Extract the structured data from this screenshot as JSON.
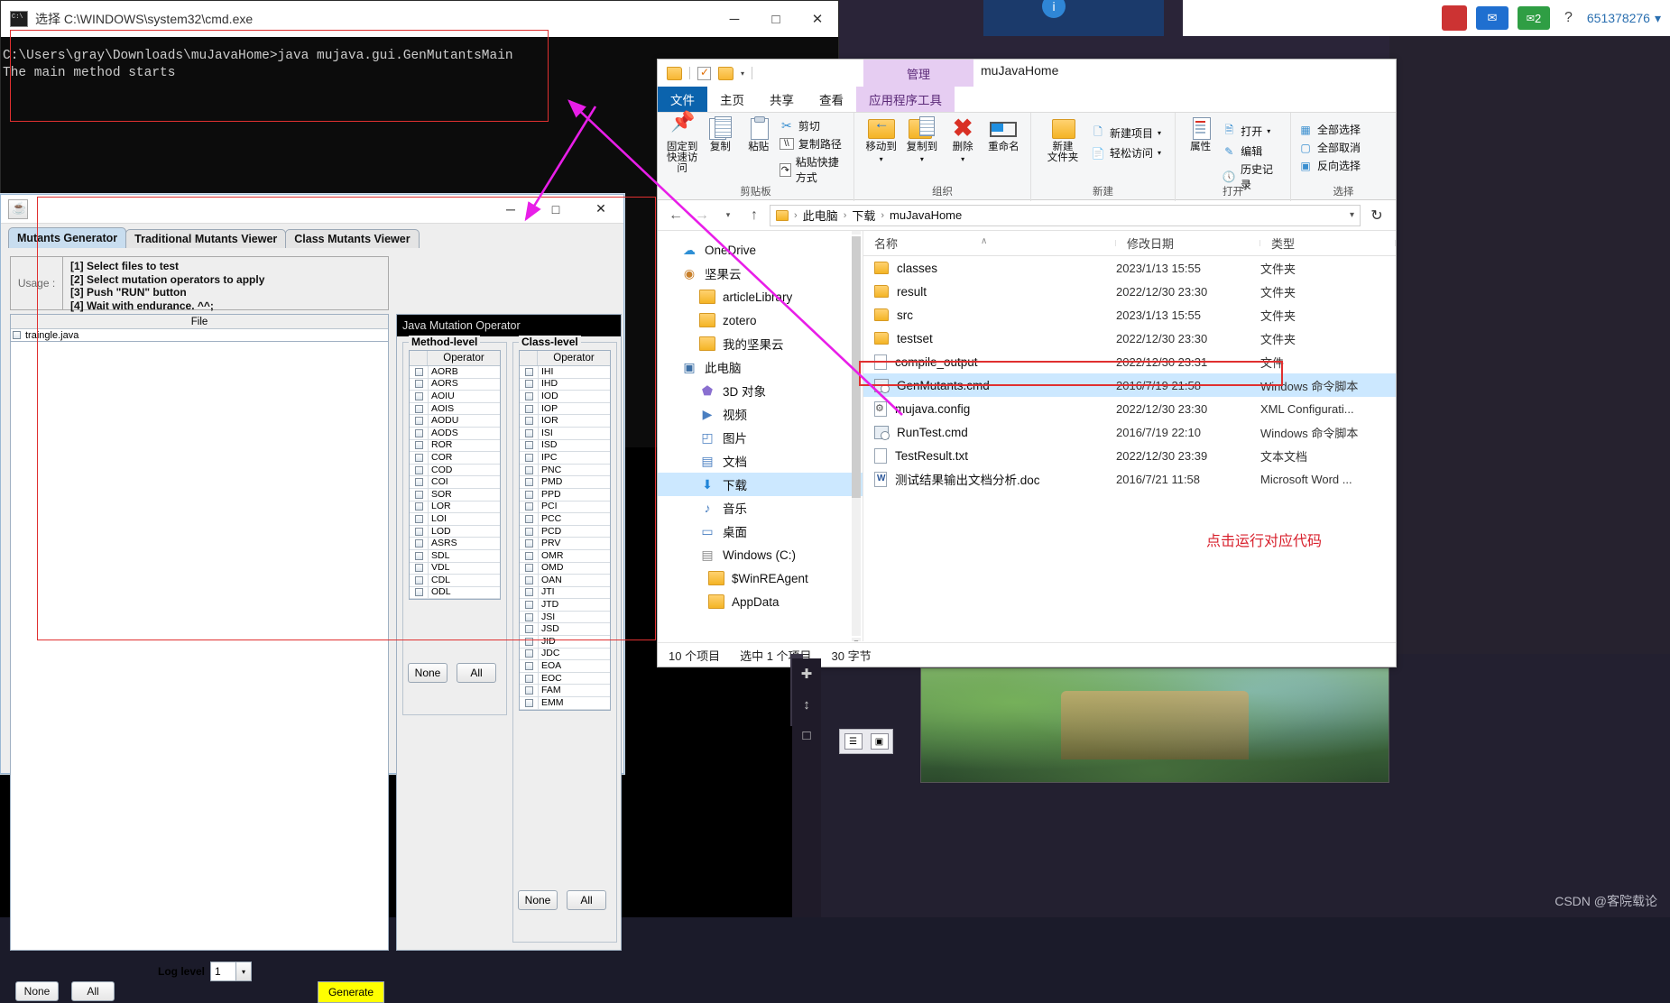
{
  "desktop": {
    "watermark": "CSDN @客院载论",
    "taskbar": {
      "mail_badge": "2",
      "help_icon": "?",
      "user_id": "651378276",
      "chevron": "▾"
    }
  },
  "cmd_window": {
    "title": "选择 C:\\WINDOWS\\system32\\cmd.exe",
    "icon": "cmd-icon",
    "minimize": "─",
    "maximize": "□",
    "close": "✕",
    "lines": [
      "C:\\Users\\gray\\Downloads\\muJavaHome>java mujava.gui.GenMutantsMain",
      "The main method starts"
    ]
  },
  "java_window": {
    "title": "",
    "minimize": "─",
    "maximize": "□",
    "close": "✕",
    "tabs": [
      {
        "label": "Mutants Generator",
        "active": true
      },
      {
        "label": "Traditional Mutants Viewer",
        "active": false
      },
      {
        "label": "Class Mutants Viewer",
        "active": false
      }
    ],
    "usage": {
      "label": "Usage :",
      "steps": [
        "[1] Select files to test",
        "[2] Select mutation operators to apply",
        "[3] Push \"RUN\" button",
        "[4] Wait with endurance. ^^;"
      ]
    },
    "file_table": {
      "header": "File",
      "rows": [
        {
          "name": "traingle.java",
          "checked": false
        }
      ]
    },
    "bottom": {
      "none_label": "None",
      "all_label": "All",
      "log_level_label": "Log level",
      "log_level_value": "1",
      "log_level_caret": "▾",
      "generate_label": "Generate",
      "generate_color": "#ffff00"
    },
    "operator_panel": {
      "title": "Java Mutation Operator",
      "method_level": {
        "legend": "Method-level",
        "column_header": "Operator",
        "operators": [
          "AORB",
          "AORS",
          "AOIU",
          "AOIS",
          "AODU",
          "AODS",
          "ROR",
          "COR",
          "COD",
          "COI",
          "SOR",
          "LOR",
          "LOI",
          "LOD",
          "ASRS",
          "SDL",
          "VDL",
          "CDL",
          "ODL"
        ],
        "none_label": "None",
        "all_label": "All"
      },
      "class_level": {
        "legend": "Class-level",
        "column_header": "Operator",
        "operators": [
          "IHI",
          "IHD",
          "IOD",
          "IOP",
          "IOR",
          "ISI",
          "ISD",
          "IPC",
          "PNC",
          "PMD",
          "PPD",
          "PCI",
          "PCC",
          "PCD",
          "PRV",
          "OMR",
          "OMD",
          "OAN",
          "JTI",
          "JTD",
          "JSI",
          "JSD",
          "JID",
          "JDC",
          "EOA",
          "EOC",
          "FAM",
          "EMM"
        ],
        "none_label": "None",
        "all_label": "All"
      }
    }
  },
  "explorer": {
    "title": "muJavaHome",
    "contextual_band": "管理",
    "quick_access": {
      "folder_icon": "folder-icon",
      "properties_icon": "checkbox-icon",
      "newfolder_icon": "folder-icon",
      "caret": "▾"
    },
    "ribbon_tabs": [
      {
        "label": "文件",
        "kind": "file"
      },
      {
        "label": "主页",
        "kind": "normal"
      },
      {
        "label": "共享",
        "kind": "normal"
      },
      {
        "label": "查看",
        "kind": "normal"
      },
      {
        "label": "应用程序工具",
        "kind": "contextual"
      }
    ],
    "ribbon_groups": [
      {
        "title": "剪贴板",
        "big": [
          {
            "label": "固定到\n快速访问",
            "icon": "pin-icon"
          },
          {
            "label": "复制",
            "icon": "copy-icon"
          },
          {
            "label": "粘贴",
            "icon": "paste-icon"
          }
        ],
        "small": [
          {
            "label": "剪切",
            "icon": "scissors-icon"
          },
          {
            "label": "复制路径",
            "icon": "copy-path-icon"
          },
          {
            "label": "粘贴快捷方式",
            "icon": "paste-shortcut-icon"
          }
        ]
      },
      {
        "title": "组织",
        "big": [
          {
            "label": "移动到",
            "icon": "move-to-icon"
          },
          {
            "label": "复制到",
            "icon": "copy-to-icon"
          },
          {
            "label": "删除",
            "icon": "delete-icon"
          },
          {
            "label": "重命名",
            "icon": "rename-icon"
          }
        ],
        "small": []
      },
      {
        "title": "新建",
        "big": [
          {
            "label": "新建\n文件夹",
            "icon": "new-folder-icon"
          }
        ],
        "small": [
          {
            "label": "新建项目",
            "icon": "new-item-icon"
          },
          {
            "label": "轻松访问",
            "icon": "easy-access-icon"
          }
        ]
      },
      {
        "title": "打开",
        "big": [
          {
            "label": "属性",
            "icon": "properties-icon"
          }
        ],
        "small": [
          {
            "label": "打开",
            "icon": "open-icon"
          },
          {
            "label": "编辑",
            "icon": "edit-icon"
          },
          {
            "label": "历史记录",
            "icon": "history-icon"
          }
        ]
      },
      {
        "title": "选择",
        "big": [],
        "small": [
          {
            "label": "全部选择",
            "icon": "select-all-icon"
          },
          {
            "label": "全部取消",
            "icon": "select-none-icon"
          },
          {
            "label": "反向选择",
            "icon": "invert-selection-icon"
          }
        ]
      }
    ],
    "address_bar": {
      "back": "←",
      "forward": "→",
      "recent": "▾",
      "up": "↑",
      "crumbs": [
        "此电脑",
        "下载",
        "muJavaHome"
      ],
      "separator": "›",
      "dropdown_caret": "▾",
      "refresh": "↻"
    },
    "nav_pane": [
      {
        "label": "OneDrive",
        "icon": "cloud-icon",
        "indent": 0,
        "selected": false
      },
      {
        "label": "坚果云",
        "icon": "nut-icon",
        "indent": 0,
        "selected": false
      },
      {
        "label": "articleLibrary",
        "icon": "folder-icon",
        "indent": 1,
        "selected": false
      },
      {
        "label": "zotero",
        "icon": "folder-icon",
        "indent": 1,
        "selected": false
      },
      {
        "label": "我的坚果云",
        "icon": "folder-icon",
        "indent": 1,
        "selected": false
      },
      {
        "label": "此电脑",
        "icon": "pc-icon",
        "indent": 0,
        "selected": false
      },
      {
        "label": "3D 对象",
        "icon": "3d-icon",
        "indent": 1,
        "selected": false
      },
      {
        "label": "视频",
        "icon": "video-icon",
        "indent": 1,
        "selected": false
      },
      {
        "label": "图片",
        "icon": "picture-icon",
        "indent": 1,
        "selected": false
      },
      {
        "label": "文档",
        "icon": "document-icon",
        "indent": 1,
        "selected": false
      },
      {
        "label": "下载",
        "icon": "download-icon",
        "indent": 1,
        "selected": true
      },
      {
        "label": "音乐",
        "icon": "music-icon",
        "indent": 1,
        "selected": false
      },
      {
        "label": "桌面",
        "icon": "desktop-icon",
        "indent": 1,
        "selected": false
      },
      {
        "label": "Windows (C:)",
        "icon": "drive-icon",
        "indent": 1,
        "selected": false
      },
      {
        "label": "$WinREAgent",
        "icon": "folder-icon",
        "indent": 2,
        "selected": false
      },
      {
        "label": "AppData",
        "icon": "folder-icon",
        "indent": 2,
        "selected": false
      }
    ],
    "list_headers": {
      "name": "名称",
      "date": "修改日期",
      "type": "类型",
      "sort_caret": "∧"
    },
    "files": [
      {
        "name": "classes",
        "date": "2023/1/13 15:55",
        "type": "文件夹",
        "icon": "folder-icon",
        "selected": false
      },
      {
        "name": "result",
        "date": "2022/12/30 23:30",
        "type": "文件夹",
        "icon": "folder-icon",
        "selected": false
      },
      {
        "name": "src",
        "date": "2023/1/13 15:55",
        "type": "文件夹",
        "icon": "folder-icon",
        "selected": false
      },
      {
        "name": "testset",
        "date": "2022/12/30 23:30",
        "type": "文件夹",
        "icon": "folder-icon",
        "selected": false
      },
      {
        "name": "compile_output",
        "date": "2022/12/30 23:31",
        "type": "文件",
        "icon": "file-icon",
        "selected": false
      },
      {
        "name": "GenMutants.cmd",
        "date": "2016/7/19 21:58",
        "type": "Windows 命令脚本",
        "icon": "cmd-script-icon",
        "selected": true
      },
      {
        "name": "mujava.config",
        "date": "2022/12/30 23:30",
        "type": "XML Configurati...",
        "icon": "config-icon",
        "selected": false
      },
      {
        "name": "RunTest.cmd",
        "date": "2016/7/19 22:10",
        "type": "Windows 命令脚本",
        "icon": "cmd-script-icon",
        "selected": false
      },
      {
        "name": "TestResult.txt",
        "date": "2022/12/30 23:39",
        "type": "文本文档",
        "icon": "text-icon",
        "selected": false
      },
      {
        "name": "测试结果输出文档分析.doc",
        "date": "2016/7/21 11:58",
        "type": "Microsoft Word ...",
        "icon": "word-icon",
        "selected": false
      }
    ],
    "status_bar": {
      "item_count": "10 个项目",
      "selection": "选中 1 个项目",
      "size": "30 字节"
    },
    "annotation": "点击运行对应代码"
  }
}
